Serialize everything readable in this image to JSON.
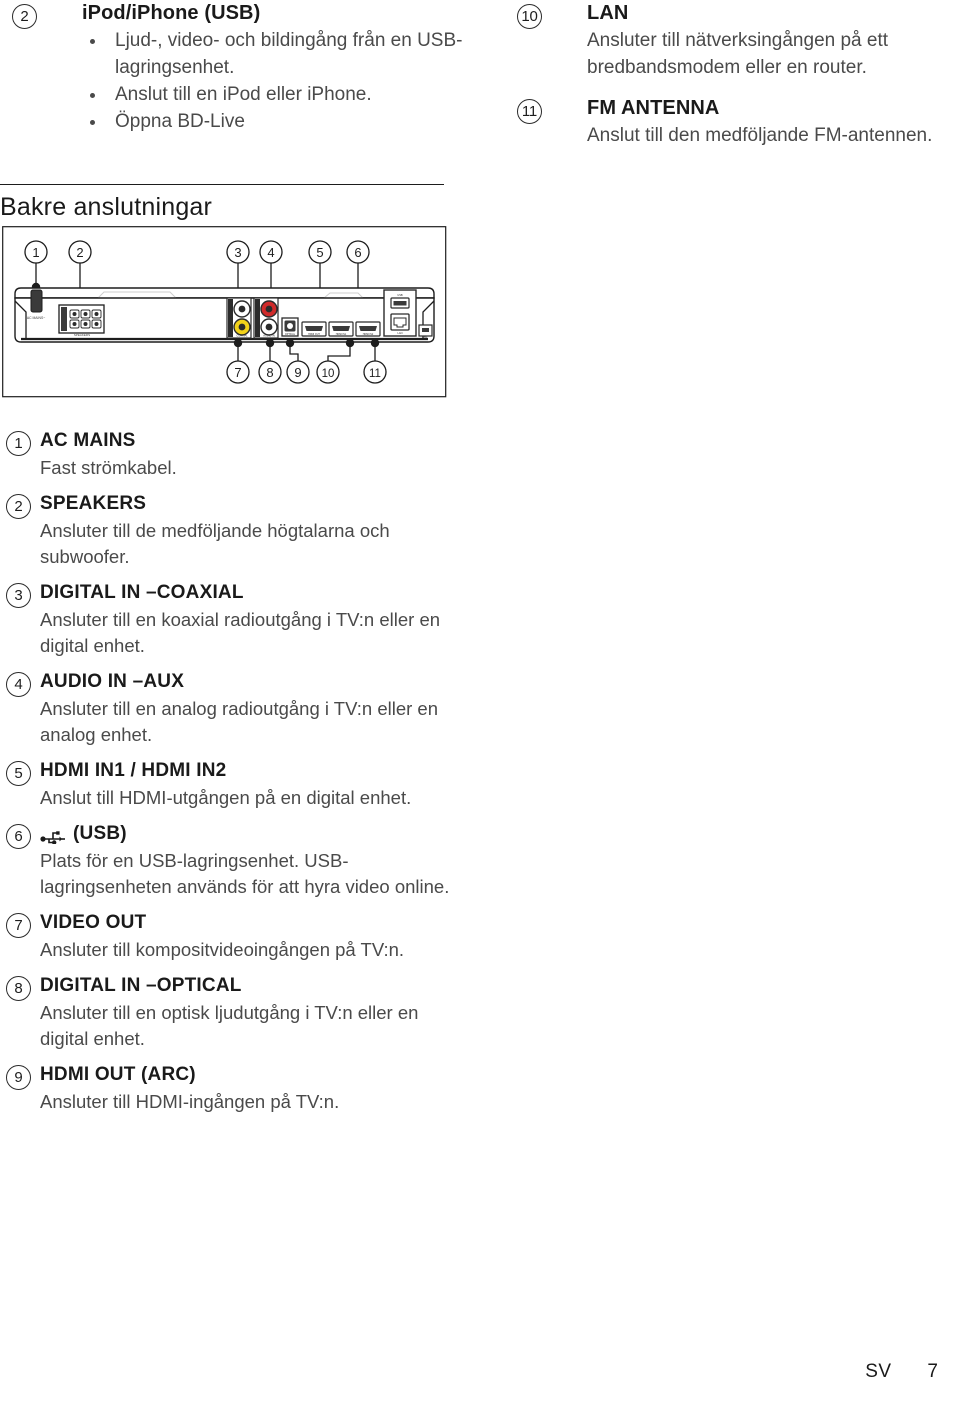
{
  "page": {
    "language_code": "SV",
    "page_number": "7"
  },
  "top_left": {
    "item": {
      "number": "2",
      "title": "iPod/iPhone (USB)",
      "bullets": [
        "Ljud-, video- och bildingång från en USB-lagringsenhet.",
        "Anslut till en iPod eller iPhone.",
        "Öppna BD-Live"
      ]
    }
  },
  "top_right": {
    "items": [
      {
        "number": "10",
        "title": "LAN",
        "description": "Ansluter till nätverksingången på ett bredbandsmodem eller en router."
      },
      {
        "number": "11",
        "title": "FM ANTENNA",
        "description": "Anslut till den medföljande FM-antennen."
      }
    ]
  },
  "section": {
    "title": "Bakre anslutningar"
  },
  "diagram": {
    "name": "rear-connections-panel",
    "callouts_top": [
      "1",
      "2",
      "3",
      "4",
      "5",
      "6"
    ],
    "callouts_bottom": [
      "7",
      "8",
      "9",
      "10",
      "11"
    ],
    "port_labels": {
      "ac_mains": "AC MAINS~",
      "speakers": "SPEAKERS",
      "coaxial": "COAXIAL",
      "video_out": "VIDEO OUT",
      "audio_in_right": "AUDIO IN",
      "audio_in_left": "AUX",
      "optical": "OPTICAL",
      "hdmi_out": "HDMI OUT",
      "hdmi_in1": "HDMI IN1",
      "hdmi_in2": "HDMI IN2",
      "usb": "USB",
      "lan": "LAN",
      "fm": "FM"
    },
    "colors": {
      "coaxial_jack": "#ffffff",
      "video_jack": "#f2d21a",
      "audio_right_jack": "#d02b2b",
      "audio_left_jack": "#ffffff",
      "body_fill": "#ffffff",
      "body_stroke": "#1d1d1d",
      "port_block": "#2b2b2b"
    }
  },
  "main_list": {
    "items": [
      {
        "number": "1",
        "title": "AC MAINS",
        "description": "Fast strömkabel."
      },
      {
        "number": "2",
        "title": "SPEAKERS",
        "description": "Ansluter till de medföljande högtalarna och subwoofer."
      },
      {
        "number": "3",
        "title": "DIGITAL IN –COAXIAL",
        "description": "Ansluter till en koaxial radioutgång i TV:n eller en digital enhet."
      },
      {
        "number": "4",
        "title": "AUDIO IN –AUX",
        "description": "Ansluter till en analog radioutgång i TV:n eller en analog enhet."
      },
      {
        "number": "5",
        "title": "HDMI IN1 / HDMI IN2",
        "description": "Anslut till HDMI-utgången på en digital enhet."
      },
      {
        "number": "6",
        "title": "(USB)",
        "icon": "usb-icon",
        "description": "Plats för en USB-lagringsenhet. USB-lagringsenheten används för att hyra video online."
      },
      {
        "number": "7",
        "title": "VIDEO OUT",
        "description": "Ansluter till kompositvideoingången på TV:n."
      },
      {
        "number": "8",
        "title": "DIGITAL IN –OPTICAL",
        "description": "Ansluter till en optisk ljudutgång i TV:n eller en digital enhet."
      },
      {
        "number": "9",
        "title": "HDMI OUT (ARC)",
        "description": "Ansluter till HDMI-ingången på TV:n."
      }
    ]
  }
}
